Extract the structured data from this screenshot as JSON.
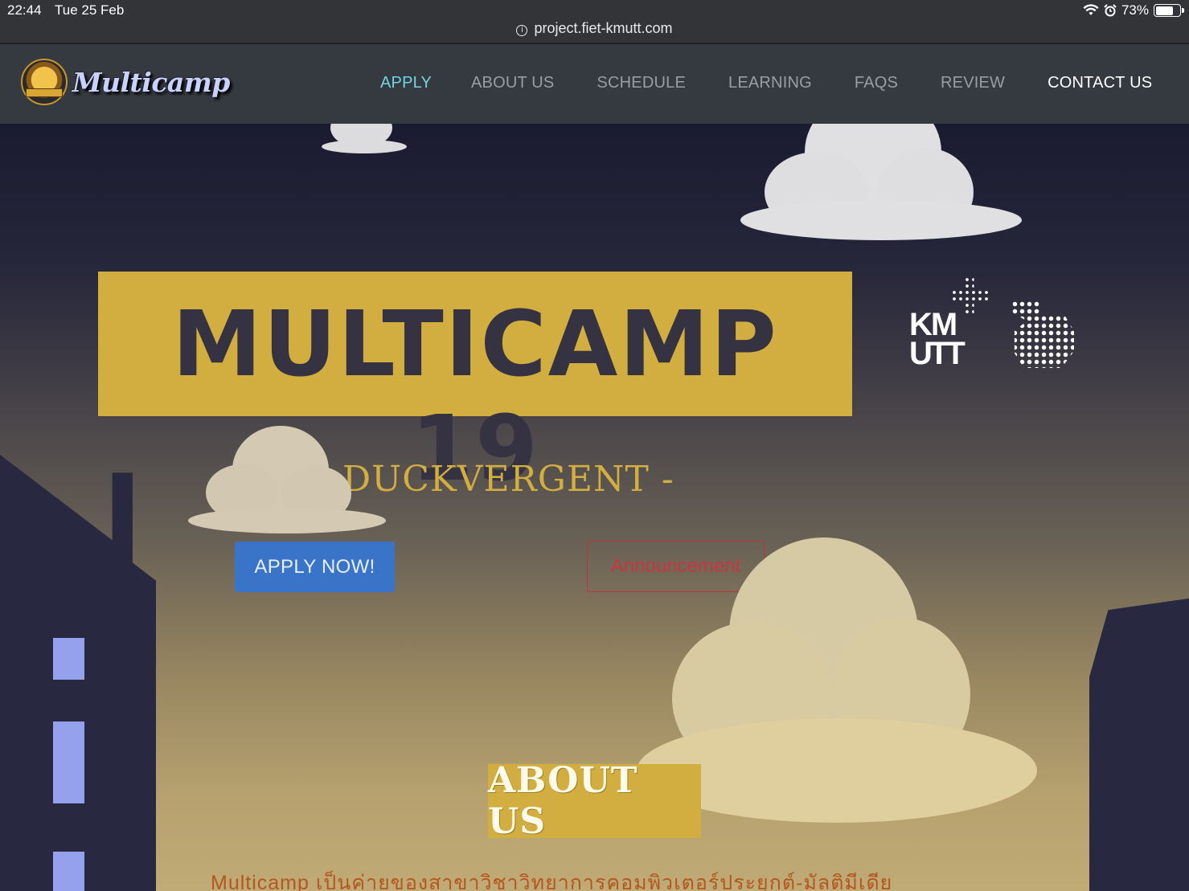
{
  "status_bar": {
    "time": "22:44",
    "date": "Tue 25 Feb",
    "battery": "73%",
    "url": "project.fiet-kmutt.com",
    "icons": [
      "wifi-icon",
      "alarm-icon",
      "battery-icon",
      "info-icon"
    ]
  },
  "navbar": {
    "brand": "Multicamp",
    "links": [
      "APPLY",
      "ABOUT US",
      "SCHEDULE",
      "LEARNING",
      "FAQS",
      "REVIEW",
      "CONTACT US"
    ],
    "active_link": "APPLY",
    "colors": {
      "background": "#343a40",
      "active": "#72d4e0",
      "link": "#9a9ea3",
      "contact": "#ffffff"
    }
  },
  "hero": {
    "title": "MULTICAMP 19",
    "subtitle": "- DUCKVERGENT -",
    "apply_button": "APPLY NOW!",
    "announcement_button": "Announcement",
    "kmutt_logo_line1": "KM",
    "kmutt_logo_line2": "UTT",
    "colors": {
      "title_bg": "#d2ad40",
      "title_text": "#353342",
      "apply_bg": "#3a74c9",
      "announce_border": "#c0323b",
      "building": "#282840",
      "window": "#95a1ec"
    }
  },
  "about": {
    "heading": "ABOUT US",
    "description": "Multicamp เป็นค่ายของสาขาวิชาวิทยาการคอมพิวเตอร์ประยุกต์-มัลติมีเดีย"
  }
}
